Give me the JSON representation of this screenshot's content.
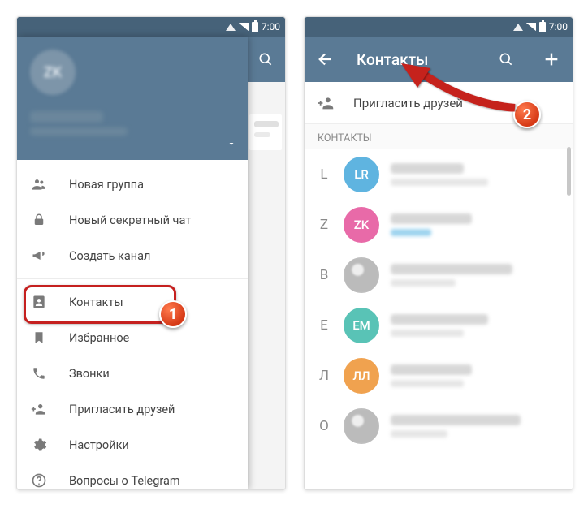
{
  "status": {
    "time": "7:00"
  },
  "left": {
    "profile": {
      "initials": "ZK"
    },
    "menu": {
      "new_group": "Новая группа",
      "new_secret": "Новый секретный чат",
      "new_channel": "Создать канал",
      "contacts": "Контакты",
      "saved": "Избранное",
      "calls": "Звонки",
      "invite": "Пригласить друзей",
      "settings": "Настройки",
      "faq": "Вопросы о Telegram"
    }
  },
  "right": {
    "title": "Контакты",
    "invite_label": "Пригласить друзей",
    "section_label": "КОНТАКТЫ",
    "contacts": [
      {
        "letter": "L",
        "initials": "LR",
        "color": "#5fb4e0",
        "nmw": 90,
        "stw": 120
      },
      {
        "letter": "Z",
        "initials": "ZK",
        "color": "#e86aa8",
        "nmw": 100,
        "stw": 50,
        "online": true
      },
      {
        "letter": "В",
        "initials": "",
        "color": "",
        "img": true,
        "nmw": 150,
        "stw": 80
      },
      {
        "letter": "Е",
        "initials": "ЕМ",
        "color": "#59c3b6",
        "nmw": 120,
        "stw": 90
      },
      {
        "letter": "Л",
        "initials": "ЛЛ",
        "color": "#f0a24f",
        "nmw": 100,
        "stw": 90
      },
      {
        "letter": "О",
        "initials": "",
        "color": "",
        "img": true,
        "nmw": 160,
        "stw": 70
      }
    ]
  },
  "badges": {
    "b1": "1",
    "b2": "2"
  }
}
